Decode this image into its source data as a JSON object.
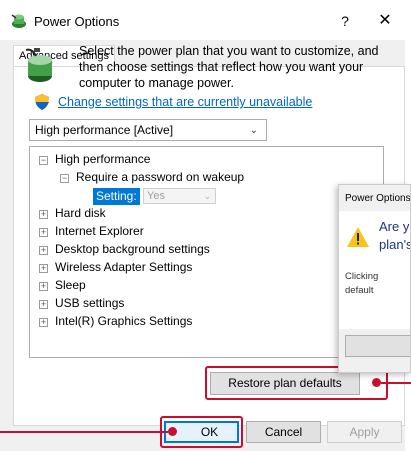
{
  "window": {
    "title": "Power Options",
    "help_glyph": "?",
    "close_glyph": "✕"
  },
  "tab": {
    "label": "Advanced settings"
  },
  "description": "Select the power plan that you want to customize, and then choose settings that reflect how you want your computer to manage power.",
  "change_link": "Change settings that are currently unavailable",
  "plan_select": {
    "value": "High performance [Active]"
  },
  "tree": {
    "root": "High performance",
    "sub": "Require a password on wakeup",
    "setting_label": "Setting:",
    "setting_value": "Yes",
    "items": [
      "Hard disk",
      "Internet Explorer",
      "Desktop background settings",
      "Wireless Adapter Settings",
      "Sleep",
      "USB settings",
      "Intel(R) Graphics Settings"
    ]
  },
  "buttons": {
    "restore": "Restore plan defaults",
    "ok": "OK",
    "cancel": "Cancel",
    "apply": "Apply"
  },
  "popup": {
    "title": "Power Options",
    "question_line1": "Are y",
    "question_line2": "plan's",
    "text_line1": "Clicking",
    "text_line2": "default"
  },
  "colors": {
    "highlight": "#c8102e",
    "link": "#0066cc",
    "selection": "#0078d7"
  },
  "icons": {
    "title": "power-plan-icon",
    "plan": "battery-plug-icon",
    "shield": "uac-shield-icon",
    "warning": "warning-icon"
  }
}
